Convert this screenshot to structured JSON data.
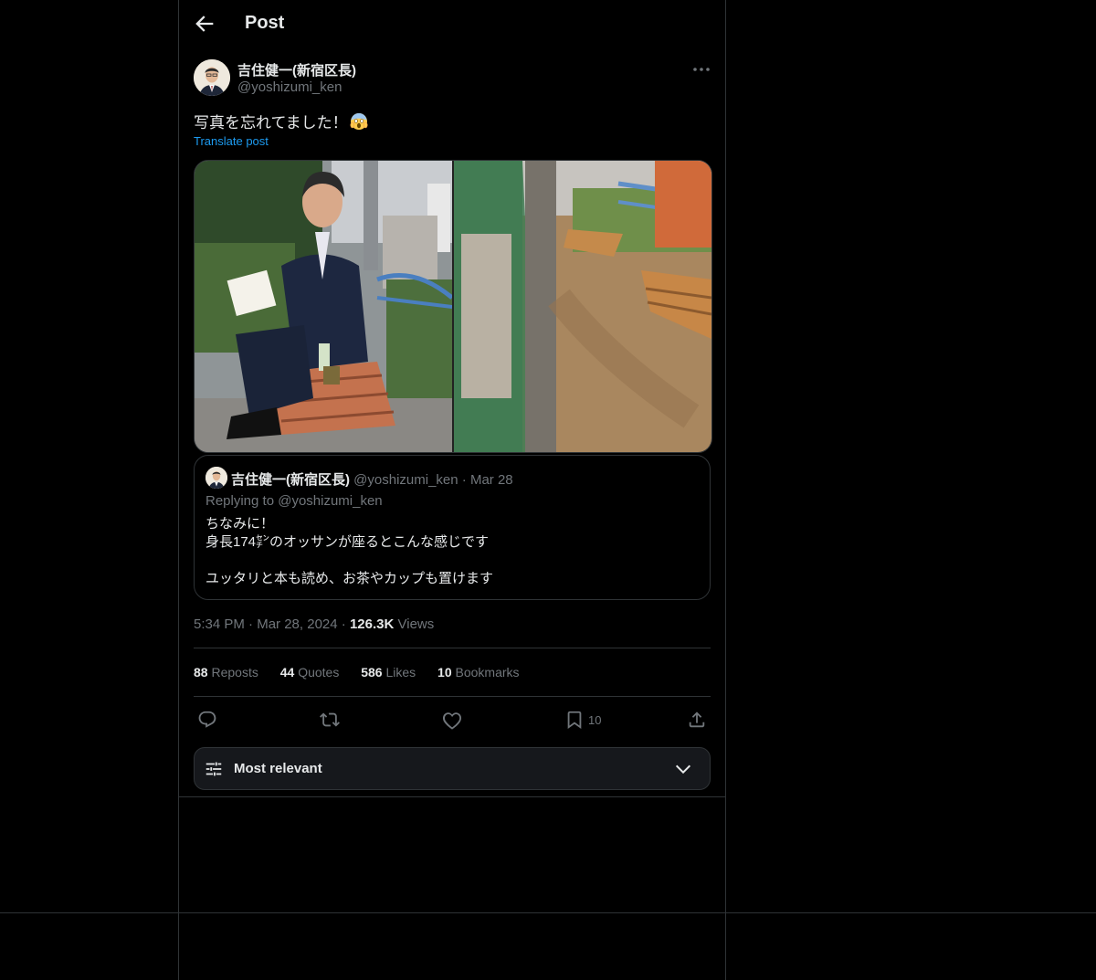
{
  "header": {
    "title": "Post"
  },
  "post": {
    "author_name": "吉住健一(新宿区長)",
    "author_handle": "@yoshizumi_ken",
    "text": "写真を忘れてました！",
    "translate_label": "Translate post",
    "media": [
      {
        "alt": "man-sitting-on-bench-photo"
      },
      {
        "alt": "empty-benches-path-photo"
      }
    ],
    "timestamp": "5:34 PM",
    "date": "Mar 28, 2024",
    "views_count": "126.3K",
    "views_label": "Views",
    "separator": "·"
  },
  "quote": {
    "author_name": "吉住健一(新宿区長)",
    "author_handle": "@yoshizumi_ken",
    "separator": "·",
    "date": "Mar 28",
    "replying_to": "Replying to @yoshizumi_ken",
    "body": "ちなみに！\n身長174㌢のオッサンが座るとこんな感じです\n\nユッタリと本も読め、お茶やカップも置けます"
  },
  "stats": {
    "reposts_count": "88",
    "reposts_label": "Reposts",
    "quotes_count": "44",
    "quotes_label": "Quotes",
    "likes_count": "586",
    "likes_label": "Likes",
    "bookmarks_count": "10",
    "bookmarks_label": "Bookmarks"
  },
  "actions": {
    "reply_icon": "reply-icon",
    "repost_icon": "repost-icon",
    "like_icon": "heart-icon",
    "bookmark_icon": "bookmark-icon",
    "bookmark_count": "10",
    "share_icon": "share-icon"
  },
  "sort": {
    "label": "Most relevant"
  },
  "colors": {
    "background": "#000000",
    "border": "#2f3336",
    "text_primary": "#e7e9ea",
    "text_secondary": "#71767b",
    "accent": "#1d9bf0"
  }
}
